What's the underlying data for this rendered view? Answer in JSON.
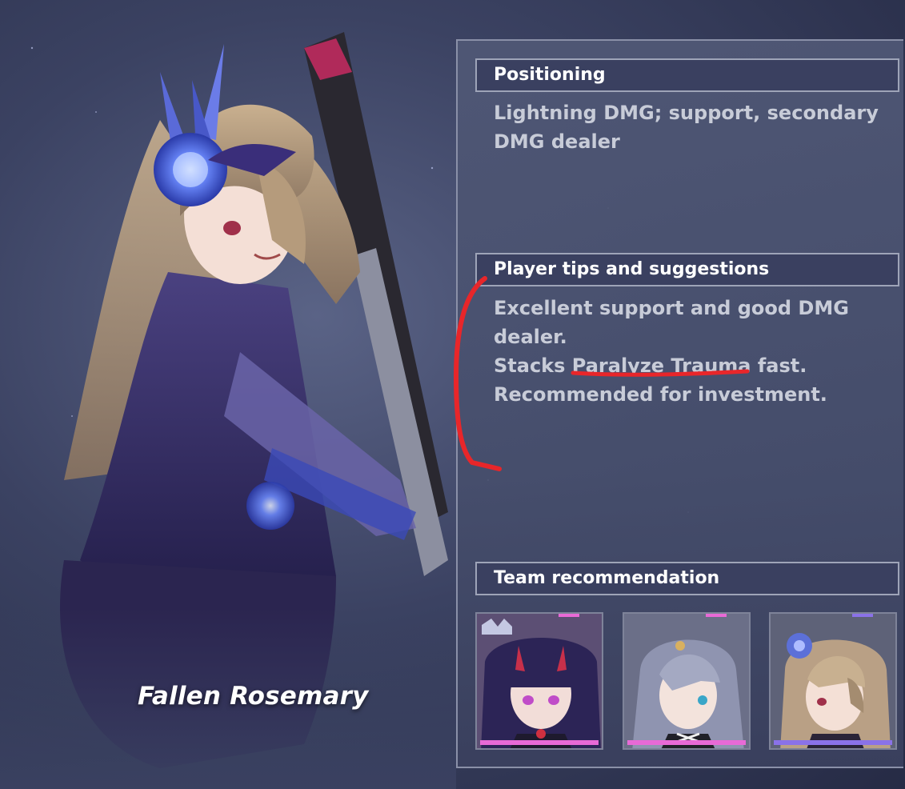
{
  "character": {
    "name": "Fallen Rosemary"
  },
  "sections": {
    "positioning": {
      "title": "Positioning",
      "lines": [
        "Lightning DMG; support, secondary",
        "DMG dealer"
      ]
    },
    "tips": {
      "title": "Player tips and suggestions",
      "lines": [
        "Excellent support and good DMG",
        "dealer.",
        "Stacks Paralyze Trauma fast.",
        "Recommended for investment."
      ]
    },
    "team": {
      "title": "Team recommendation",
      "members": [
        {
          "portrait": "dark-haired-horned-valkyrie-portrait",
          "accent": "#e86ad6"
        },
        {
          "portrait": "silver-haired-valkyrie-portrait",
          "accent": "#e86ad6"
        },
        {
          "portrait": "fallen-rosemary-portrait",
          "accent": "#8a72e8"
        }
      ]
    }
  },
  "annotation": {
    "color": "#e8262a",
    "underlined_text": "Paralyze Trauma"
  }
}
